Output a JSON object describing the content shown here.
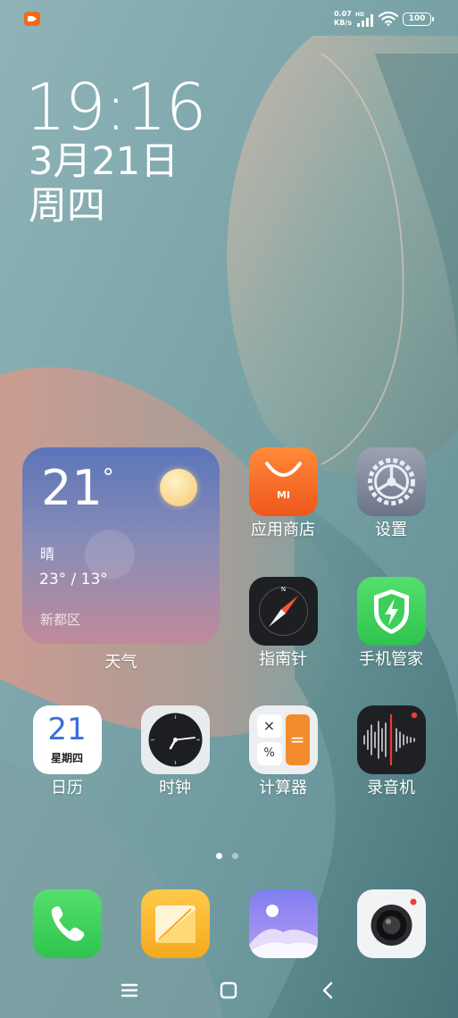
{
  "status_bar": {
    "recording_indicator": "record-icon",
    "net_speed_value": "0.07",
    "net_speed_unit": "KB/s",
    "network_label": "HD",
    "signal_icon": "signal-icon",
    "wifi_icon": "wifi-icon",
    "battery_level": "100"
  },
  "clock": {
    "time": "19:16",
    "date": "3月21日",
    "weekday": "周四"
  },
  "weather_widget": {
    "temperature": "21",
    "degree_symbol": "°",
    "condition": "晴",
    "range": "23° / 13°",
    "location": "新都区",
    "label": "天气",
    "icon": "sun-icon"
  },
  "apps": {
    "app_store": {
      "label": "应用商店",
      "icon": "app-store-bag-icon",
      "badge": "MI"
    },
    "settings": {
      "label": "设置",
      "icon": "gear-icon"
    },
    "compass": {
      "label": "指南针",
      "icon": "compass-icon",
      "north": "N"
    },
    "security": {
      "label": "手机管家",
      "icon": "shield-lightning-icon"
    },
    "calendar": {
      "label": "日历",
      "icon": "calendar-icon",
      "day": "21",
      "weekday": "星期四"
    },
    "clock": {
      "label": "时钟",
      "icon": "clock-icon"
    },
    "calculator": {
      "label": "计算器",
      "icon": "calculator-icon"
    },
    "recorder": {
      "label": "录音机",
      "icon": "sound-wave-icon"
    }
  },
  "page_indicator": {
    "pages": 2,
    "current": 1
  },
  "dock": [
    {
      "name": "phone",
      "icon": "phone-icon"
    },
    {
      "name": "notes",
      "icon": "notes-icon"
    },
    {
      "name": "gallery",
      "icon": "gallery-icon"
    },
    {
      "name": "camera",
      "icon": "camera-icon"
    }
  ],
  "nav_bar": {
    "menu_icon": "menu-icon",
    "home_icon": "home-square-icon",
    "back_icon": "back-chevron-icon"
  },
  "colors": {
    "wallpaper_teal": "#7fa3a8",
    "app_store_orange": "#f06a22",
    "security_green": "#3ccf5a",
    "calculator_orange": "#f28a2e",
    "phone_green": "#3ccf5a",
    "notes_yellow": "#f7b731"
  }
}
